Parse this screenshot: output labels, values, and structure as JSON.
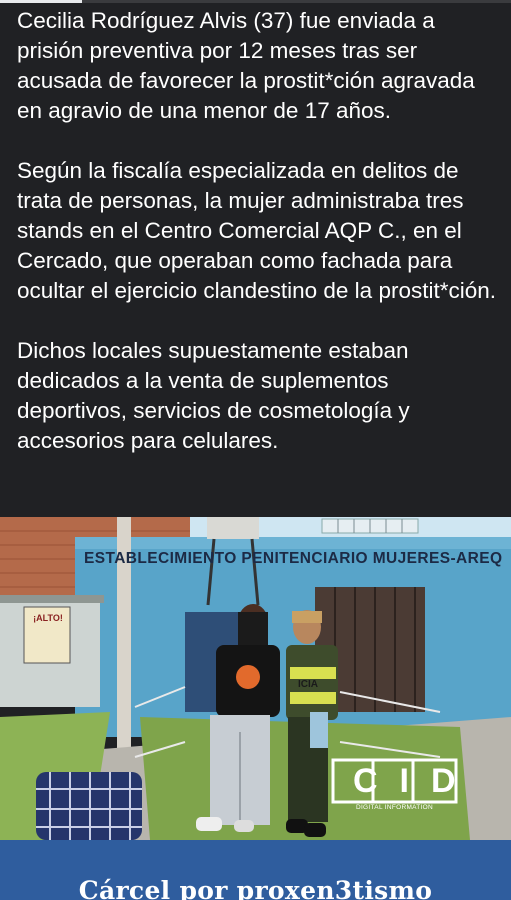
{
  "progress": {
    "value": 0.16
  },
  "post": {
    "paragraphs": [
      "Cecilia Rodríguez Alvis (37) fue enviada a prisión preventiva por 12 meses tras ser acusada de favorecer la prostit*ción agravada en agravio de una menor de 17 años.",
      "Según la fiscalía especializada en delitos de trata de personas, la mujer administraba tres stands en el Centro Comercial AQP C., en el Cercado, que operaban como fachada para ocultar el ejercicio clandestino de la prostit*ción.",
      "Dichos locales supuestamente estaban dedicados a la venta de suplementos deportivos, servicios de cosmetología y accesorios para celulares."
    ]
  },
  "photo": {
    "building_sign": "ESTABLECIMIENTO PENITENCIARIO MUJERES-AREQ",
    "door_sign_top": "¡ALTO!",
    "police_vest_text": "ICIA",
    "watermark_logo": "CID",
    "watermark_caption": "DIGITAL INFORMATION"
  },
  "card": {
    "title": "Cárcel por proxen3tismo"
  },
  "colors": {
    "background": "#202124",
    "card": "#2f5d9e",
    "wall": "#58a4c9"
  }
}
